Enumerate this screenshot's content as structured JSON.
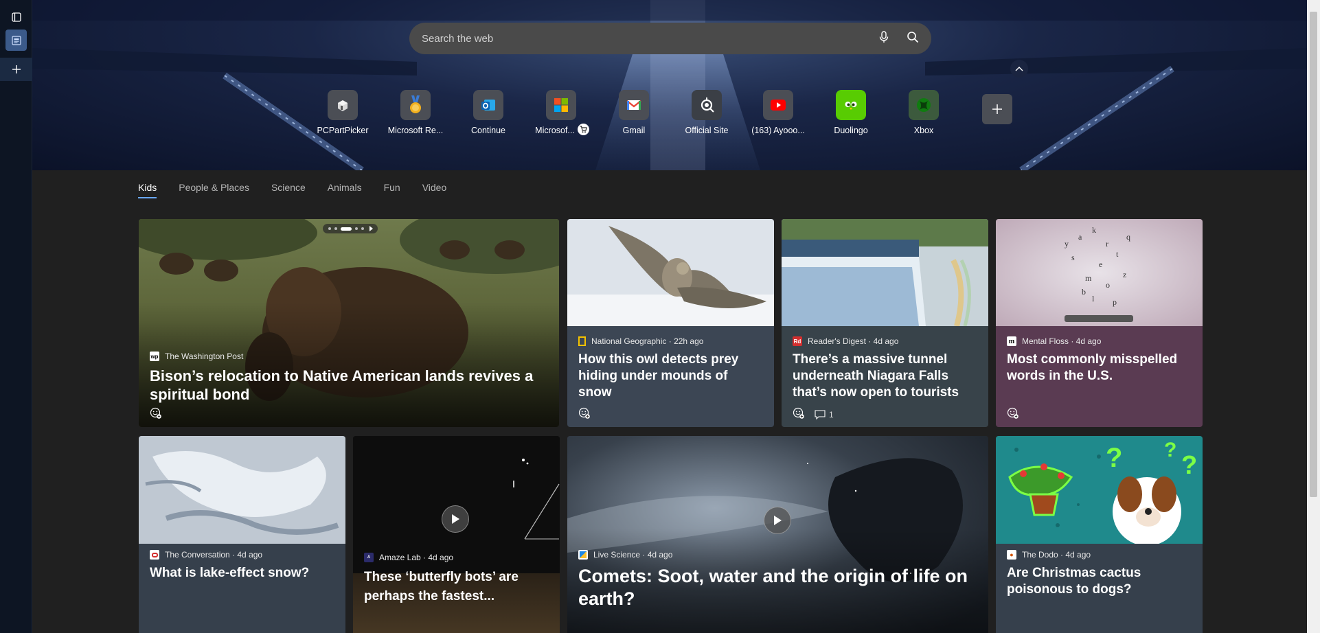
{
  "search": {
    "placeholder": "Search the web"
  },
  "quick_links": [
    {
      "label": "PCPartPicker",
      "icon": "pcpartpicker-icon"
    },
    {
      "label": "Microsoft Re...",
      "icon": "microsoft-rewards-icon"
    },
    {
      "label": "Continue",
      "icon": "outlook-icon"
    },
    {
      "label": "Microsof...",
      "icon": "microsoft-store-icon"
    },
    {
      "label": "Gmail",
      "icon": "gmail-icon"
    },
    {
      "label": "Official Site",
      "icon": "steelseries-icon"
    },
    {
      "label": "(163) Ayooo...",
      "icon": "youtube-icon"
    },
    {
      "label": "Duolingo",
      "icon": "duolingo-icon"
    },
    {
      "label": "Xbox",
      "icon": "xbox-icon"
    }
  ],
  "tabs": [
    "Kids",
    "People & Places",
    "Science",
    "Animals",
    "Fun",
    "Video"
  ],
  "cards": [
    {
      "source": "The Washington Post",
      "title": "Bison’s relocation to Native American lands revives a spiritual bond"
    },
    {
      "source": "National Geographic · 22h ago",
      "title": "How this owl detects prey hiding under mounds of snow"
    },
    {
      "source": "Reader's Digest · 4d ago",
      "title": "There’s a massive tunnel underneath Niagara Falls that’s now open to tourists",
      "comments": "1"
    },
    {
      "source": "Mental Floss · 4d ago",
      "title": "Most commonly misspelled words in the U.S."
    },
    {
      "source": "The Conversation · 4d ago",
      "title": "What is lake-effect snow?"
    },
    {
      "source": "Amaze Lab · 4d ago",
      "title": "These ‘butterfly bots’ are perhaps the fastest..."
    },
    {
      "source": "Live Science · 4d ago",
      "title": "Comets: Soot, water and the origin of life on earth?"
    },
    {
      "source": "The Dodo · 4d ago",
      "title": "Are Christmas cactus poisonous to dogs?"
    }
  ],
  "colors": {
    "accent": "#69a7ff",
    "page_bg": "#202020",
    "sidebar_bg": "#0d1523"
  }
}
